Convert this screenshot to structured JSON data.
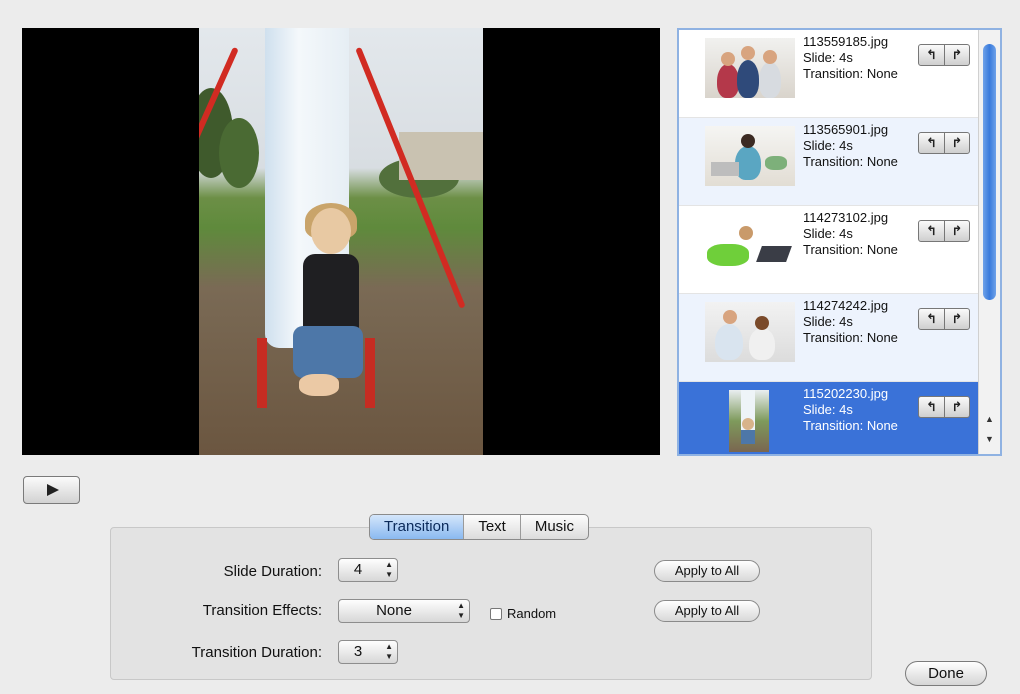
{
  "preview": {
    "description_icon": "photo-preview"
  },
  "slides": [
    {
      "filename": "113559185.jpg",
      "duration": "Slide: 4s",
      "transition": "Transition: None",
      "state": "normal"
    },
    {
      "filename": "113565901.jpg",
      "duration": "Slide: 4s",
      "transition": "Transition: None",
      "state": "alt"
    },
    {
      "filename": "114273102.jpg",
      "duration": "Slide: 4s",
      "transition": "Transition: None",
      "state": "normal"
    },
    {
      "filename": "114274242.jpg",
      "duration": "Slide: 4s",
      "transition": "Transition: None",
      "state": "alt"
    },
    {
      "filename": "115202230.jpg",
      "duration": "Slide: 4s",
      "transition": "Transition: None",
      "state": "selected"
    }
  ],
  "move_buttons": {
    "up": "↰",
    "down": "↱"
  },
  "scroll_arrows": {
    "up": "▲",
    "down": "▼"
  },
  "play_icon": "play-icon",
  "tabs": [
    {
      "label": "Transition",
      "active": true
    },
    {
      "label": "Text",
      "active": false
    },
    {
      "label": "Music",
      "active": false
    }
  ],
  "settings": {
    "slide_duration_label": "Slide Duration:",
    "slide_duration_value": "4",
    "transition_effects_label": "Transition Effects:",
    "transition_effects_value": "None",
    "random_label": "Random",
    "random_checked": false,
    "transition_duration_label": "Transition Duration:",
    "transition_duration_value": "3",
    "apply_all_label": "Apply to All"
  },
  "done_label": "Done",
  "select_arrows": "▲▼",
  "colors": {
    "selection": "#3a72d8",
    "scroll_thumb": "#3a7bdc",
    "tab_active": "#8ab9f0"
  }
}
